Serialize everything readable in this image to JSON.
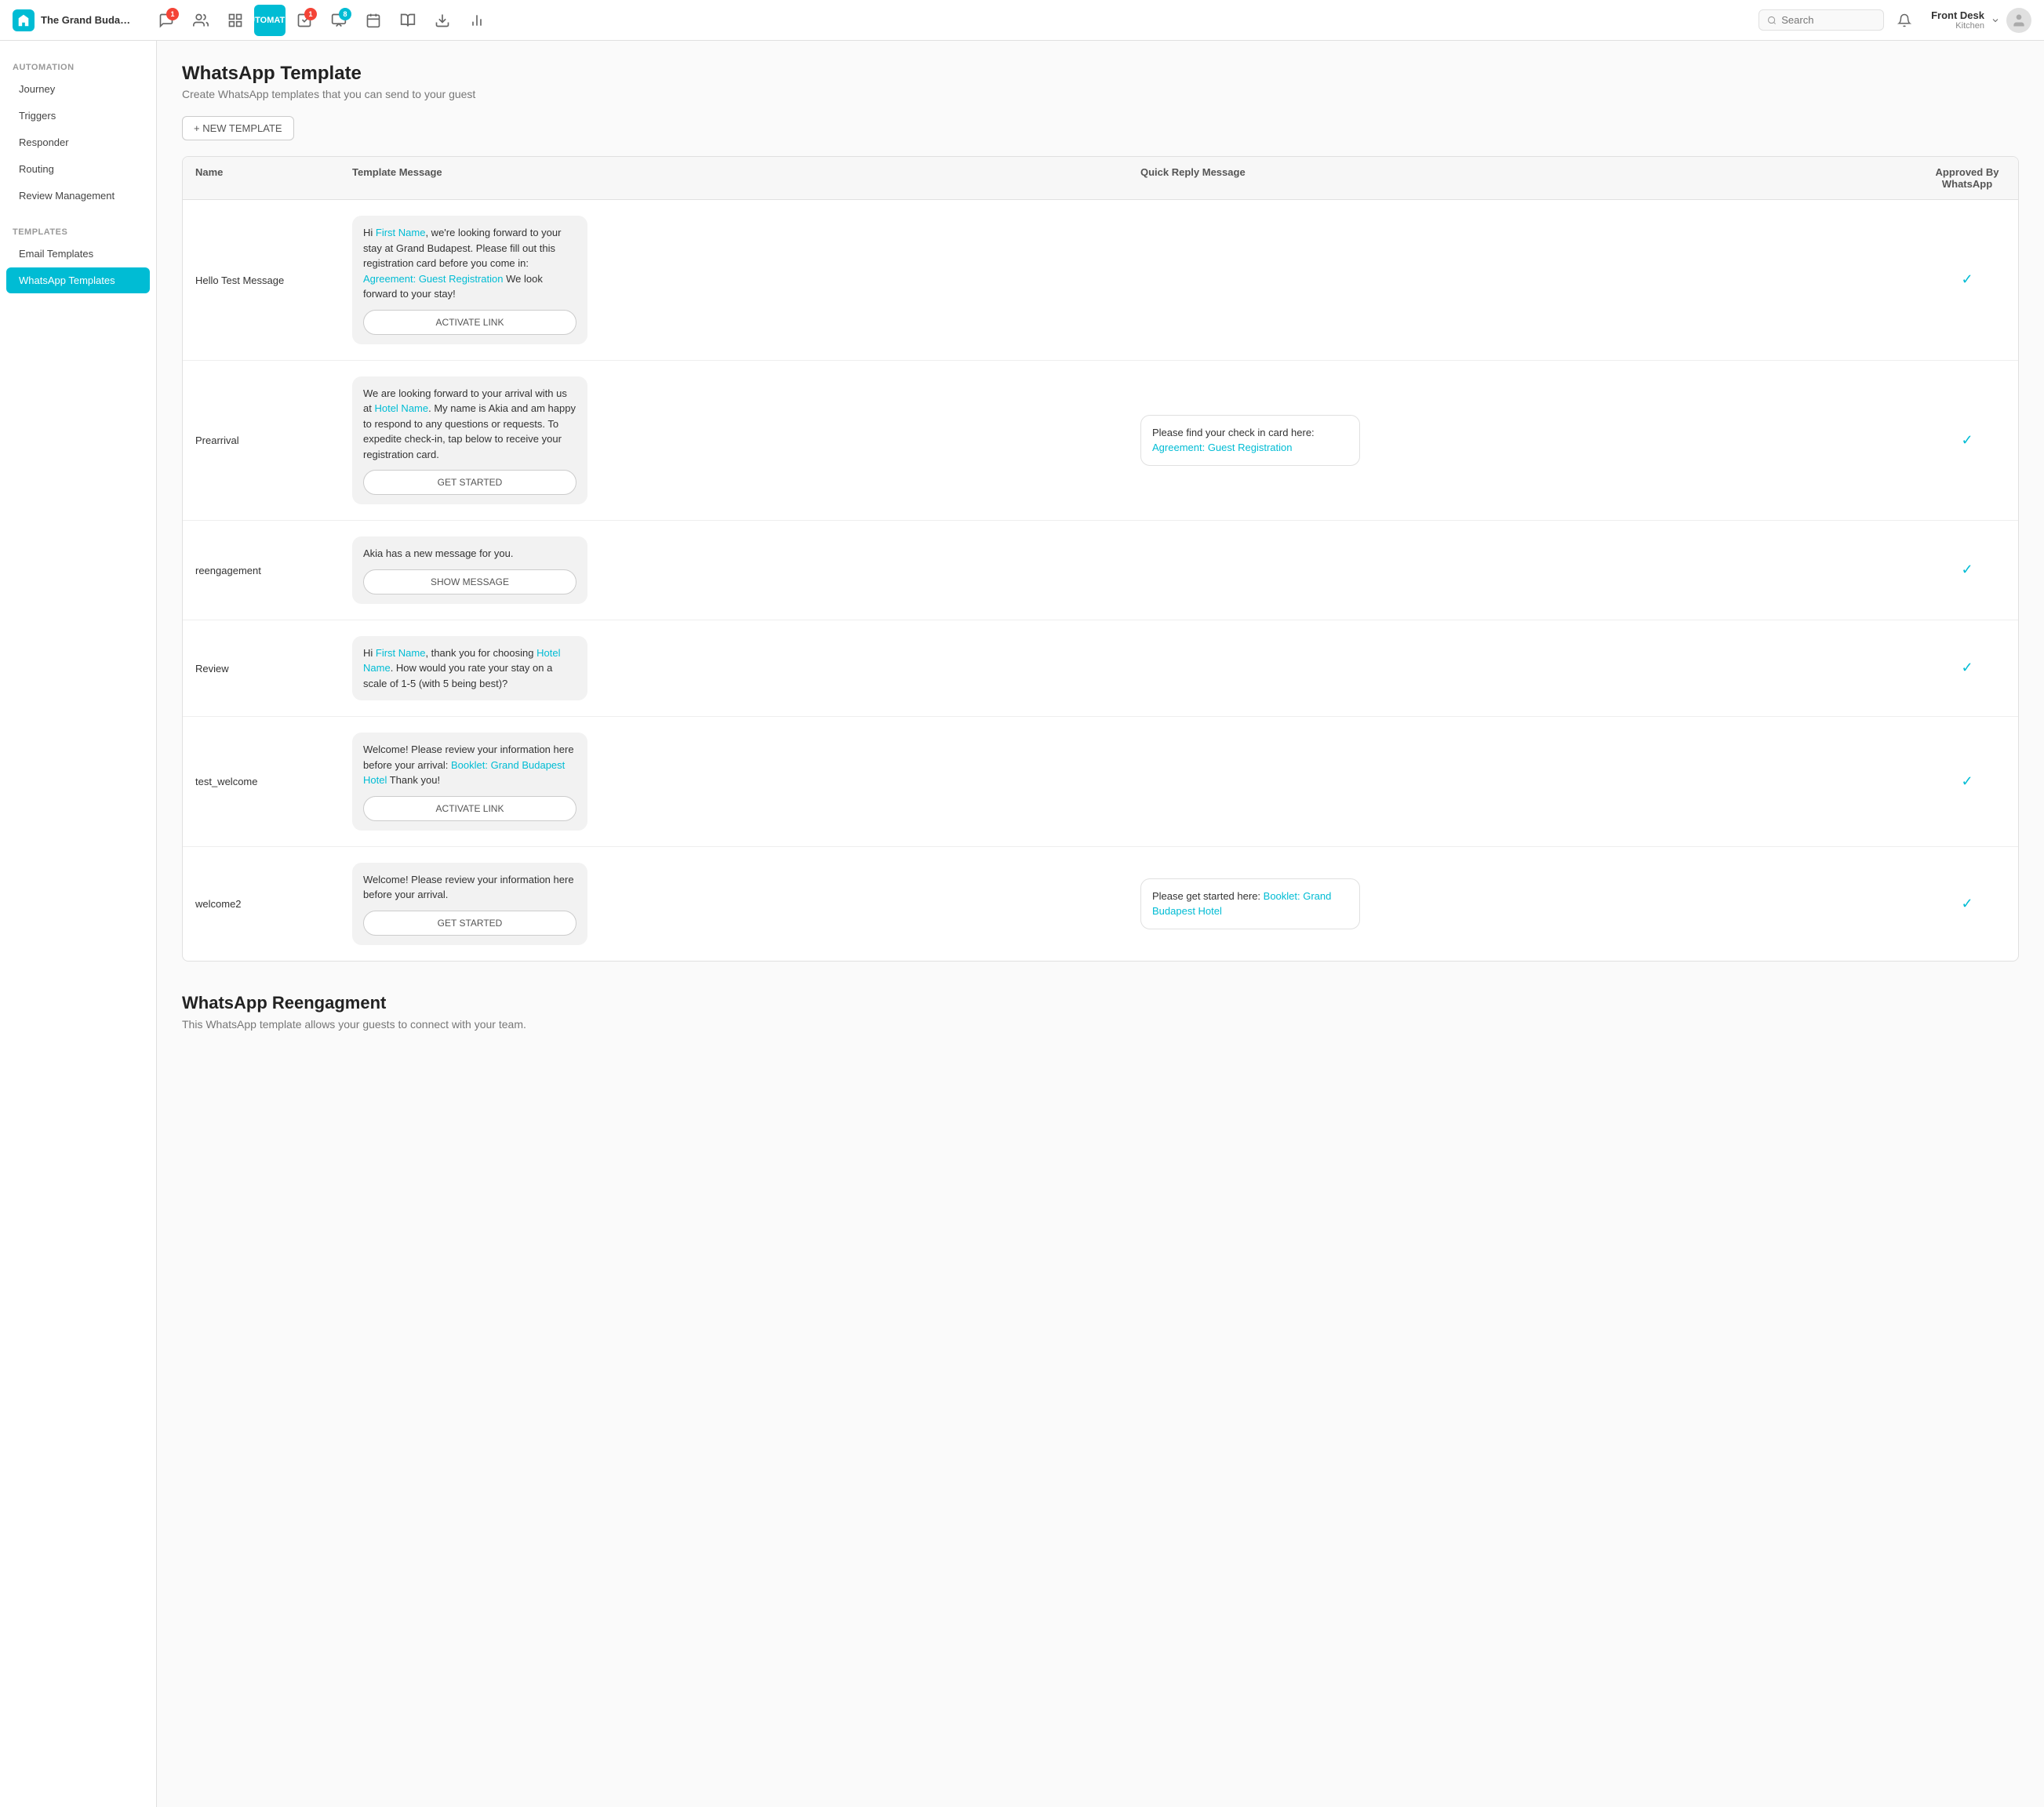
{
  "nav": {
    "hotel_name": "The Grand Budape...",
    "automation_label": "AUTOMATION",
    "search_placeholder": "Search",
    "user_name": "Front Desk",
    "user_role": "Kitchen",
    "badges": {
      "messages": 1,
      "tasks": 1,
      "notifications": 8
    }
  },
  "sidebar": {
    "automation_label": "AUTOMATION",
    "templates_label": "TEMPLATES",
    "items_automation": [
      {
        "id": "journey",
        "label": "Journey"
      },
      {
        "id": "triggers",
        "label": "Triggers"
      },
      {
        "id": "responder",
        "label": "Responder"
      },
      {
        "id": "routing",
        "label": "Routing"
      },
      {
        "id": "review",
        "label": "Review Management"
      }
    ],
    "items_templates": [
      {
        "id": "email",
        "label": "Email Templates"
      },
      {
        "id": "whatsapp",
        "label": "WhatsApp Templates",
        "active": true
      }
    ]
  },
  "page": {
    "title": "WhatsApp Template",
    "subtitle": "Create WhatsApp templates that you can send to your guest",
    "new_template_btn": "+ NEW TEMPLATE",
    "table_headers": {
      "name": "Name",
      "template_message": "Template Message",
      "quick_reply": "Quick Reply Message",
      "approved": "Approved By WhatsApp"
    }
  },
  "templates": [
    {
      "name": "Hello Test Message",
      "message_parts": [
        {
          "type": "text",
          "text": "Hi "
        },
        {
          "type": "link",
          "text": "First Name"
        },
        {
          "type": "text",
          "text": ", we're looking forward to your stay at Grand Budapest. Please fill out this registration card before you come in: "
        },
        {
          "type": "link",
          "text": "Agreement: Guest Registration"
        },
        {
          "type": "text",
          "text": " We look forward to your stay!"
        }
      ],
      "message_btn": "ACTIVATE LINK",
      "quick_reply": null,
      "approved": true
    },
    {
      "name": "Prearrival",
      "message_parts": [
        {
          "type": "text",
          "text": "We are looking forward to your arrival with us at "
        },
        {
          "type": "link",
          "text": "Hotel Name"
        },
        {
          "type": "text",
          "text": ". My name is Akia and am happy to respond to any questions or requests. To expedite check-in, tap below to receive your registration card."
        }
      ],
      "message_btn": "GET STARTED",
      "quick_reply": {
        "text": "Please find your check in card here: ",
        "link_text": "Agreement: Guest Registration"
      },
      "approved": true
    },
    {
      "name": "reengagement",
      "message_parts": [
        {
          "type": "text",
          "text": "Akia has a new message for you."
        }
      ],
      "message_btn": "SHOW MESSAGE",
      "quick_reply": null,
      "approved": true
    },
    {
      "name": "Review",
      "message_parts": [
        {
          "type": "text",
          "text": "Hi "
        },
        {
          "type": "link",
          "text": "First Name"
        },
        {
          "type": "text",
          "text": ", thank you for choosing "
        },
        {
          "type": "link",
          "text": "Hotel Name"
        },
        {
          "type": "text",
          "text": ". How would you rate your stay on a scale of 1-5 (with 5 being best)?"
        }
      ],
      "message_btn": null,
      "quick_reply": null,
      "approved": true
    },
    {
      "name": "test_welcome",
      "message_parts": [
        {
          "type": "text",
          "text": "Welcome! Please review your information here before your arrival: "
        },
        {
          "type": "link",
          "text": "Booklet: Grand Budapest Hotel"
        },
        {
          "type": "text",
          "text": " Thank you!"
        }
      ],
      "message_btn": "ACTIVATE LINK",
      "quick_reply": null,
      "approved": true
    },
    {
      "name": "welcome2",
      "message_parts": [
        {
          "type": "text",
          "text": "Welcome! Please review your information here before your arrival."
        }
      ],
      "message_btn": "GET STARTED",
      "quick_reply": {
        "text": "Please get started here: ",
        "link_text": "Booklet: Grand Budapest Hotel"
      },
      "approved": true
    }
  ],
  "reengagement_section": {
    "title": "WhatsApp Reengagment",
    "subtitle": "This WhatsApp template allows your guests to connect with your team."
  }
}
